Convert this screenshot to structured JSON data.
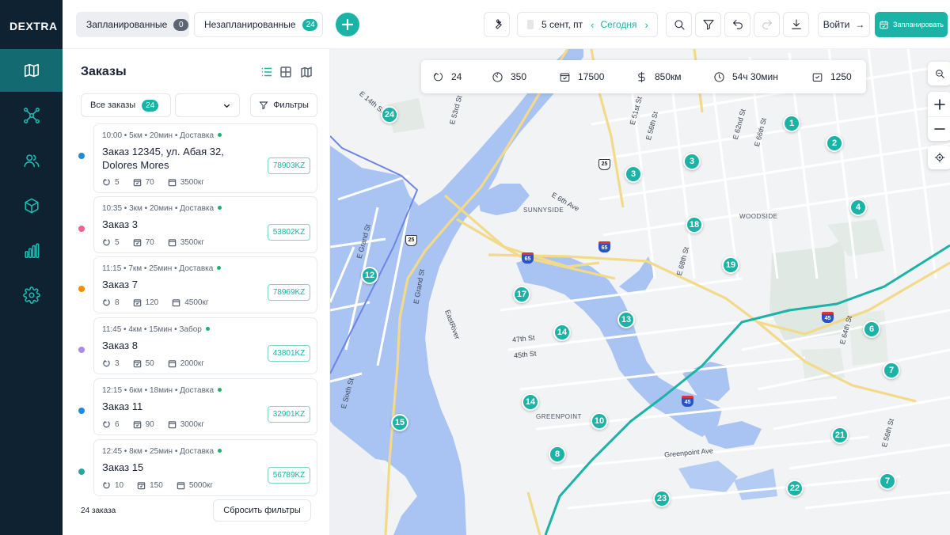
{
  "app": {
    "logo": "DEXTRA"
  },
  "sidebar": {
    "items": [
      {
        "label": "map",
        "icon": "map-icon",
        "active": true
      },
      {
        "label": "network",
        "icon": "network-icon"
      },
      {
        "label": "users",
        "icon": "users-icon"
      },
      {
        "label": "packages",
        "icon": "box-icon"
      },
      {
        "label": "analytics",
        "icon": "chart-icon"
      },
      {
        "label": "settings",
        "icon": "gear-icon"
      }
    ]
  },
  "topbar": {
    "tab_planned": {
      "label": "Запланированные",
      "count": "0"
    },
    "tab_unplanned": {
      "label": "Незапланированные",
      "count": "24"
    },
    "date": {
      "label": "5 сент, пт",
      "today": "Сегодня"
    },
    "login": "Войти",
    "plan_button": "Запланировать"
  },
  "panel": {
    "title": "Заказы",
    "filter_all": {
      "label": "Все заказы",
      "count": "24"
    },
    "filters_label": "Фильтры",
    "footer_count": "24 заказа",
    "reset_label": "Сбросить фильтры",
    "orders": [
      {
        "meta": "10:00 • 5км • 20мин • Доставка",
        "name": "Заказ 12345, ул. Абая 32, Dolores Mores",
        "stops": "5",
        "boxes": "70",
        "weight": "3500кг",
        "code": "78903KZ",
        "color": "#1e88e5"
      },
      {
        "meta": "10:35 • 3км • 20мин • Доставка",
        "name": "Заказ 3",
        "stops": "5",
        "boxes": "70",
        "weight": "3500кг",
        "code": "53802KZ",
        "color": "#f06292"
      },
      {
        "meta": "11:15 • 7км • 25мин • Доставка",
        "name": "Заказ 7",
        "stops": "8",
        "boxes": "120",
        "weight": "4500кг",
        "code": "78969KZ",
        "color": "#fb8c00"
      },
      {
        "meta": "11:45 • 4км • 15мин • Забор",
        "name": "Заказ 8",
        "stops": "3",
        "boxes": "50",
        "weight": "2000кг",
        "code": "43801KZ",
        "color": "#ab8ae8"
      },
      {
        "meta": "12:15 • 6км • 18мин • Доставка",
        "name": "Заказ 11",
        "stops": "6",
        "boxes": "90",
        "weight": "3000кг",
        "code": "32901KZ",
        "color": "#1e88e5"
      },
      {
        "meta": "12:45 • 8км • 25мин • Доставка",
        "name": "Заказ 15",
        "stops": "10",
        "boxes": "150",
        "weight": "5000кг",
        "code": "56789KZ",
        "color": "#26a69a"
      }
    ]
  },
  "map": {
    "stats": {
      "stops": "24",
      "speed": "350",
      "boxes": "17500",
      "distance": "850км",
      "time": "54ч 30мин",
      "weight": "1250"
    },
    "labels": [
      "SUNNYSIDE",
      "WOODSIDE",
      "GREENPOINT",
      "47th St",
      "45th St",
      "E 14th St",
      "E 53rd St",
      "E 51st St",
      "E 56th St",
      "E 62nd St",
      "E 6th Ave",
      "E 68th St",
      "E Grand St",
      "E 66th St",
      "E 64th St",
      "Greenpoint Ave",
      "EastRiver",
      "E Grand St",
      "E Sixth St",
      "E 56th St"
    ],
    "pins": [
      "24",
      "1",
      "2",
      "3",
      "3",
      "4",
      "18",
      "19",
      "12",
      "17",
      "13",
      "14",
      "6",
      "7",
      "14",
      "10",
      "15",
      "21",
      "8",
      "22",
      "7",
      "23"
    ],
    "shields": [
      "25",
      "25",
      "65",
      "65",
      "45",
      "45"
    ]
  }
}
